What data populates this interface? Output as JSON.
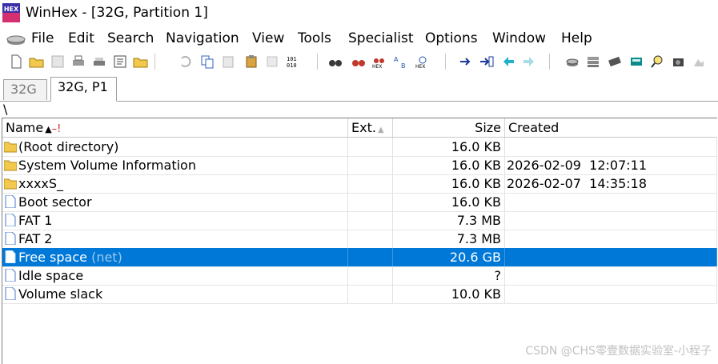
{
  "window": {
    "title": "WinHex - [32G, Partition 1]",
    "app_icon": "winhex-app-icon"
  },
  "menu": {
    "items": [
      "File",
      "Edit",
      "Search",
      "Navigation",
      "View",
      "Tools",
      "Specialist",
      "Options",
      "Window",
      "Help"
    ]
  },
  "toolbar": {
    "buttons": [
      "new-file-icon",
      "open-folder-icon",
      "save-icon",
      "print-icon",
      "print-setup-icon",
      "properties-icon",
      "open-folder-icon",
      "undo-icon",
      "copy-icon",
      "paste-icon",
      "clipboard-icon",
      "copy-block-icon",
      "binary-icon",
      "find-text-icon",
      "find-hex-icon",
      "replace-text-icon",
      "replace-hex-icon",
      "search-hex-icon",
      "goto-offset-icon",
      "goto-sector-icon",
      "back-icon",
      "forward-icon",
      "open-disk-icon",
      "disk-stack-icon",
      "ram-editor-icon",
      "calculator-icon",
      "magnifier-icon",
      "camera-icon",
      "info-icon"
    ]
  },
  "tabs": [
    {
      "label": "32G",
      "active": false
    },
    {
      "label": "32G, P1",
      "active": true
    }
  ],
  "path": "\\",
  "table": {
    "columns": {
      "name": "Name",
      "ext": "Ext.",
      "size": "Size",
      "created": "Created"
    },
    "rows": [
      {
        "name": "(Root directory)",
        "ext": "",
        "size": "16.0 KB",
        "created": "",
        "icon": "folder-icon",
        "selected": false
      },
      {
        "name": "System Volume Information",
        "ext": "",
        "size": "16.0 KB",
        "created": "2026-02-09  12:07:11",
        "icon": "folder-icon",
        "selected": false
      },
      {
        "name": "xxxxS_",
        "ext": "",
        "size": "16.0 KB",
        "created": "2026-02-07  14:35:18",
        "icon": "folder-icon",
        "selected": false
      },
      {
        "name": "Boot sector",
        "ext": "",
        "size": "16.0 KB",
        "created": "",
        "icon": "file-icon",
        "selected": false
      },
      {
        "name": "FAT 1",
        "ext": "",
        "size": "7.3 MB",
        "created": "",
        "icon": "file-icon",
        "selected": false
      },
      {
        "name": "FAT 2",
        "ext": "",
        "size": "7.3 MB",
        "created": "",
        "icon": "file-icon",
        "selected": false
      },
      {
        "name": "Free space",
        "name_suffix": "(net)",
        "ext": "",
        "size": "20.6 GB",
        "created": "",
        "icon": "file-icon",
        "selected": true
      },
      {
        "name": "Idle space",
        "ext": "",
        "size": "?",
        "created": "",
        "icon": "file-icon",
        "selected": false
      },
      {
        "name": "Volume slack",
        "ext": "",
        "size": "10.0 KB",
        "created": "",
        "icon": "file-icon",
        "selected": false
      }
    ]
  },
  "watermark": "CSDN @CHS零壹数据实验室-小程子",
  "colors": {
    "selection": "#0078d7",
    "folder": "#f2c94c"
  }
}
